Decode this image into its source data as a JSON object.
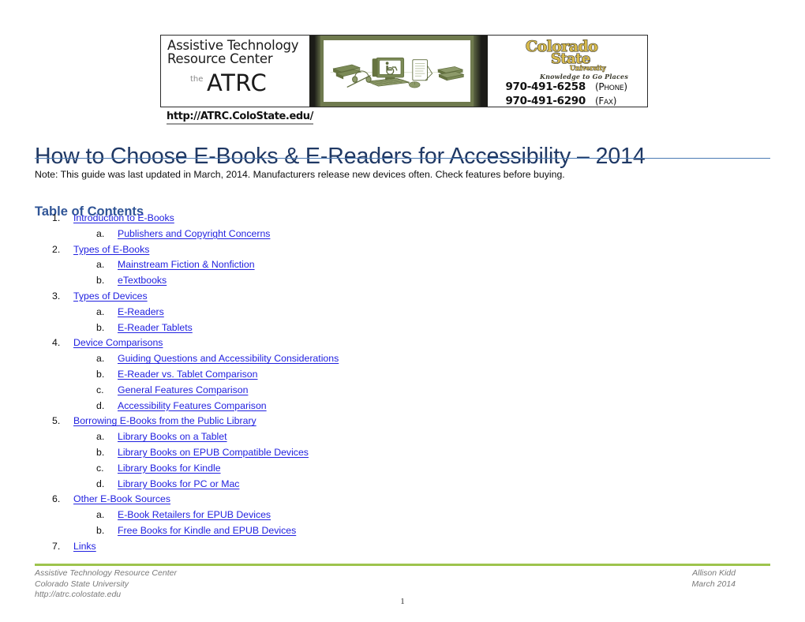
{
  "banner": {
    "atrc_line1": "Assistive Technology",
    "atrc_line2": "Resource Center",
    "atrc_the": "the",
    "atrc_acronym": "ATRC",
    "center_art_alt": "assistive-technology-devices-illustration",
    "csu_word1": "Colorado",
    "csu_word2": "State",
    "csu_word3": "University",
    "csu_tagline": "Knowledge to Go Places",
    "phone_number": "970-491-6258",
    "phone_label_prefix": "P",
    "phone_label_rest": "HONE",
    "fax_number": "970-491-6290",
    "fax_label_prefix": "F",
    "fax_label_rest": "AX",
    "url": "http://ATRC.ColoState.edu/"
  },
  "title": "How to Choose E-Books & E-Readers for Accessibility – 2014",
  "note": "Note: This guide was last updated in March, 2014. Manufacturers release new devices often. Check features before buying.",
  "toc": {
    "heading": "Table of Contents",
    "items": [
      {
        "level": 1,
        "marker": "1.",
        "label": "Introduction to E-Books"
      },
      {
        "level": 2,
        "marker": "a.",
        "label": "Publishers and Copyright Concerns"
      },
      {
        "level": 1,
        "marker": "2.",
        "label": "Types of E-Books"
      },
      {
        "level": 2,
        "marker": "a.",
        "label": "Mainstream Fiction & Nonfiction"
      },
      {
        "level": 2,
        "marker": "b.",
        "label": "eTextbooks"
      },
      {
        "level": 1,
        "marker": "3.",
        "label": "Types of Devices"
      },
      {
        "level": 2,
        "marker": "a.",
        "label": "E-Readers"
      },
      {
        "level": 2,
        "marker": "b.",
        "label": "E-Reader Tablets"
      },
      {
        "level": 1,
        "marker": "4.",
        "label": "Device Comparisons"
      },
      {
        "level": 2,
        "marker": "a.",
        "label": "Guiding Questions and Accessibility Considerations"
      },
      {
        "level": 2,
        "marker": "b.",
        "label": "E-Reader vs. Tablet Comparison"
      },
      {
        "level": 2,
        "marker": "c.",
        "label": "General Features Comparison"
      },
      {
        "level": 2,
        "marker": "d.",
        "label": "Accessibility Features Comparison"
      },
      {
        "level": 1,
        "marker": "5.",
        "label": "Borrowing E-Books from the Public Library"
      },
      {
        "level": 2,
        "marker": "a.",
        "label": "Library Books on a Tablet"
      },
      {
        "level": 2,
        "marker": "b.",
        "label": "Library Books on EPUB Compatible Devices"
      },
      {
        "level": 2,
        "marker": "c.",
        "label": "Library Books for Kindle"
      },
      {
        "level": 2,
        "marker": "d.",
        "label": "Library Books for PC or Mac"
      },
      {
        "level": 1,
        "marker": "6.",
        "label": "Other E-Book Sources"
      },
      {
        "level": 2,
        "marker": "a.",
        "label": "E-Book Retailers for EPUB Devices"
      },
      {
        "level": 2,
        "marker": "b.",
        "label": "Free Books for Kindle and EPUB Devices"
      },
      {
        "level": 1,
        "marker": "7.",
        "label": "Links"
      }
    ]
  },
  "footer": {
    "left_line1": "Assistive Technology Resource Center",
    "left_line2": "Colorado State University",
    "left_line3": "http://atrc.colostate.edu",
    "right_line1": "Allison Kidd",
    "right_line2": "March 2014",
    "page_number": "1"
  },
  "colors": {
    "title_blue": "#1f3864",
    "heading_blue": "#2f5496",
    "link_blue": "#2121e0",
    "title_rule": "#4a7ab4",
    "footer_rule_green": "#9dc44d",
    "banner_olive": "#6f7a4e",
    "csu_gold": "#d6b94c"
  }
}
